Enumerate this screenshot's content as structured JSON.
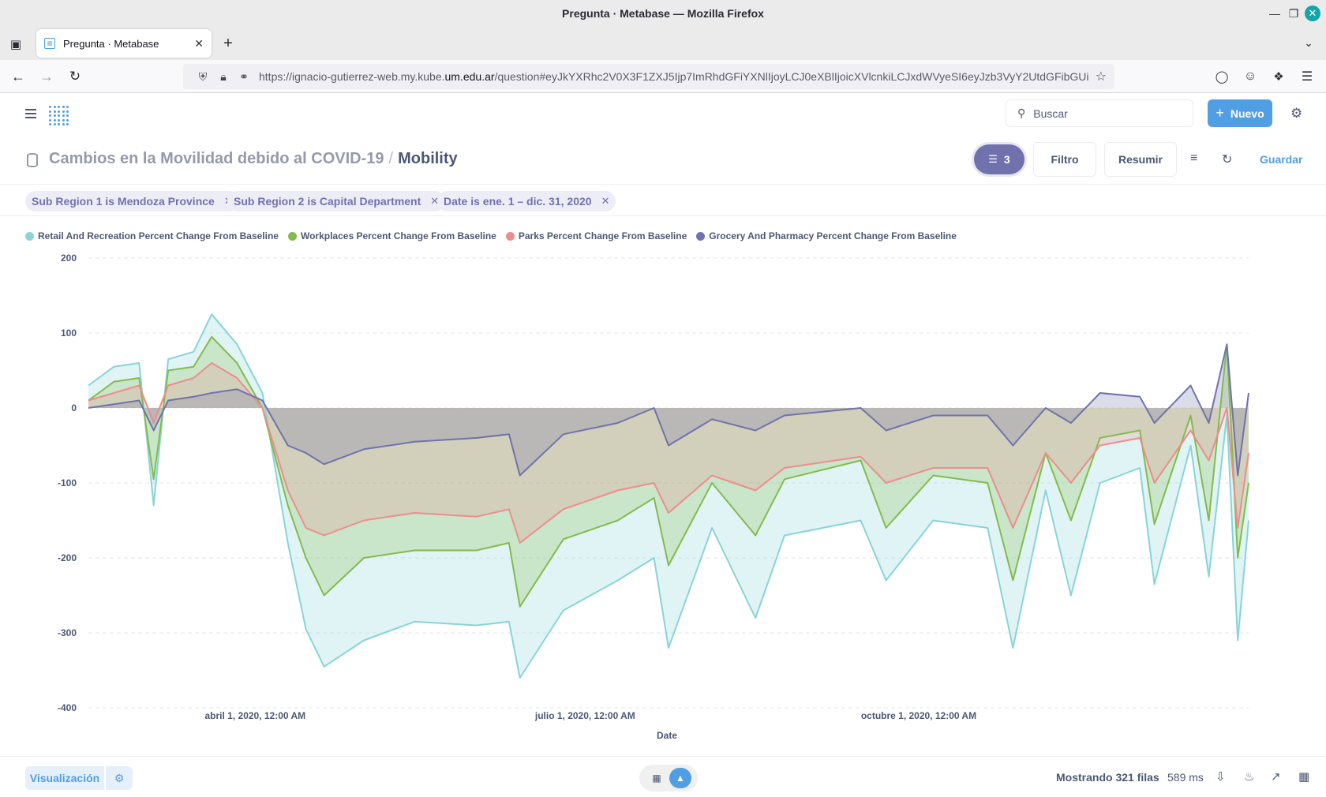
{
  "browser": {
    "window_title": "Pregunta · Metabase — Mozilla Firefox",
    "tab_title": "Pregunta · Metabase",
    "url_prefix": "https://ignacio-gutierrez-web.my.kube.",
    "url_domain": "um.edu.ar",
    "url_suffix": "/question#eyJkYXRhc2V0X3F1ZXJ5Ijp7ImRhdGFiYXNlIjoyLCJ0eXBlIjoicXVlcnkiLCJxdWVyeSI6eyJzb3VyY2UtdGFibGUi"
  },
  "header": {
    "search_placeholder": "Buscar",
    "new_label": "Nuevo"
  },
  "question": {
    "collection": "Cambios en la Movilidad debido al COVID-19",
    "separator": "/",
    "table": "Mobility",
    "filter_count": "3",
    "filter_btn": "Filtro",
    "summarize_btn": "Resumir",
    "save_btn": "Guardar"
  },
  "filters": [
    "Sub Region 1 is Mendoza Province",
    "Sub Region 2 is Capital Department",
    "Date is ene. 1 – dic. 31, 2020"
  ],
  "footer": {
    "viz_label": "Visualización",
    "rows_text": "Mostrando 321 filas",
    "time_text": "589 ms"
  },
  "colors": {
    "accent": "#509ee3",
    "filter": "#7172ad",
    "retail": "#88d4d8",
    "workplaces": "#84bb4c",
    "parks": "#ef8c8c",
    "grocery": "#7172ad"
  },
  "chart_data": {
    "type": "area",
    "xlabel": "Date",
    "ylabel": "",
    "x_range": [
      "2020-02-15",
      "2020-12-31"
    ],
    "x_ticks": [
      "abril 1, 2020, 12:00 AM",
      "julio 1, 2020, 12:00 AM",
      "octubre 1, 2020, 12:00 AM"
    ],
    "ylim": [
      -400,
      200
    ],
    "y_ticks": [
      "200",
      "100",
      "0",
      "-100",
      "-200",
      "-300",
      "-400"
    ],
    "legend_position": "top-left",
    "series": [
      {
        "name": "Retail And Recreation Percent Change From Baseline",
        "values": [
          [
            "2020-02-15",
            30
          ],
          [
            "2020-02-22",
            55
          ],
          [
            "2020-02-29",
            60
          ],
          [
            "2020-03-04",
            -130
          ],
          [
            "2020-03-08",
            65
          ],
          [
            "2020-03-15",
            75
          ],
          [
            "2020-03-20",
            125
          ],
          [
            "2020-03-27",
            85
          ],
          [
            "2020-04-03",
            20
          ],
          [
            "2020-04-10",
            -180
          ],
          [
            "2020-04-15",
            -295
          ],
          [
            "2020-04-20",
            -345
          ],
          [
            "2020-05-01",
            -310
          ],
          [
            "2020-05-15",
            -285
          ],
          [
            "2020-06-01",
            -290
          ],
          [
            "2020-06-10",
            -285
          ],
          [
            "2020-06-13",
            -360
          ],
          [
            "2020-06-25",
            -270
          ],
          [
            "2020-07-10",
            -230
          ],
          [
            "2020-07-20",
            -200
          ],
          [
            "2020-07-24",
            -320
          ],
          [
            "2020-08-05",
            -160
          ],
          [
            "2020-08-17",
            -280
          ],
          [
            "2020-08-25",
            -170
          ],
          [
            "2020-09-15",
            -150
          ],
          [
            "2020-09-22",
            -230
          ],
          [
            "2020-10-05",
            -150
          ],
          [
            "2020-10-20",
            -160
          ],
          [
            "2020-10-27",
            -320
          ],
          [
            "2020-11-05",
            -110
          ],
          [
            "2020-11-12",
            -250
          ],
          [
            "2020-11-20",
            -100
          ],
          [
            "2020-12-01",
            -80
          ],
          [
            "2020-12-05",
            -235
          ],
          [
            "2020-12-15",
            -50
          ],
          [
            "2020-12-20",
            -225
          ],
          [
            "2020-12-25",
            -10
          ],
          [
            "2020-12-28",
            -310
          ],
          [
            "2020-12-31",
            -150
          ]
        ]
      },
      {
        "name": "Workplaces Percent Change From Baseline",
        "values": [
          [
            "2020-02-15",
            10
          ],
          [
            "2020-02-22",
            35
          ],
          [
            "2020-02-29",
            40
          ],
          [
            "2020-03-04",
            -95
          ],
          [
            "2020-03-08",
            50
          ],
          [
            "2020-03-15",
            55
          ],
          [
            "2020-03-20",
            95
          ],
          [
            "2020-03-27",
            60
          ],
          [
            "2020-04-03",
            0
          ],
          [
            "2020-04-10",
            -130
          ],
          [
            "2020-04-15",
            -200
          ],
          [
            "2020-04-20",
            -250
          ],
          [
            "2020-05-01",
            -200
          ],
          [
            "2020-05-15",
            -190
          ],
          [
            "2020-06-01",
            -190
          ],
          [
            "2020-06-10",
            -180
          ],
          [
            "2020-06-13",
            -265
          ],
          [
            "2020-06-25",
            -175
          ],
          [
            "2020-07-10",
            -150
          ],
          [
            "2020-07-20",
            -120
          ],
          [
            "2020-07-24",
            -210
          ],
          [
            "2020-08-05",
            -100
          ],
          [
            "2020-08-17",
            -170
          ],
          [
            "2020-08-25",
            -95
          ],
          [
            "2020-09-15",
            -70
          ],
          [
            "2020-09-22",
            -160
          ],
          [
            "2020-10-05",
            -90
          ],
          [
            "2020-10-20",
            -100
          ],
          [
            "2020-10-27",
            -230
          ],
          [
            "2020-11-05",
            -60
          ],
          [
            "2020-11-12",
            -150
          ],
          [
            "2020-11-20",
            -40
          ],
          [
            "2020-12-01",
            -30
          ],
          [
            "2020-12-05",
            -155
          ],
          [
            "2020-12-15",
            -10
          ],
          [
            "2020-12-20",
            -150
          ],
          [
            "2020-12-25",
            85
          ],
          [
            "2020-12-28",
            -200
          ],
          [
            "2020-12-31",
            -100
          ]
        ]
      },
      {
        "name": "Parks Percent Change From Baseline",
        "values": [
          [
            "2020-02-15",
            10
          ],
          [
            "2020-02-22",
            20
          ],
          [
            "2020-02-29",
            30
          ],
          [
            "2020-03-04",
            -20
          ],
          [
            "2020-03-08",
            30
          ],
          [
            "2020-03-15",
            40
          ],
          [
            "2020-03-20",
            60
          ],
          [
            "2020-03-27",
            40
          ],
          [
            "2020-04-03",
            0
          ],
          [
            "2020-04-10",
            -110
          ],
          [
            "2020-04-15",
            -160
          ],
          [
            "2020-04-20",
            -170
          ],
          [
            "2020-05-01",
            -150
          ],
          [
            "2020-05-15",
            -140
          ],
          [
            "2020-06-01",
            -145
          ],
          [
            "2020-06-10",
            -135
          ],
          [
            "2020-06-13",
            -180
          ],
          [
            "2020-06-25",
            -135
          ],
          [
            "2020-07-10",
            -110
          ],
          [
            "2020-07-20",
            -100
          ],
          [
            "2020-07-24",
            -140
          ],
          [
            "2020-08-05",
            -90
          ],
          [
            "2020-08-17",
            -110
          ],
          [
            "2020-08-25",
            -80
          ],
          [
            "2020-09-15",
            -65
          ],
          [
            "2020-09-22",
            -100
          ],
          [
            "2020-10-05",
            -80
          ],
          [
            "2020-10-20",
            -80
          ],
          [
            "2020-10-27",
            -160
          ],
          [
            "2020-11-05",
            -60
          ],
          [
            "2020-11-12",
            -100
          ],
          [
            "2020-11-20",
            -50
          ],
          [
            "2020-12-01",
            -40
          ],
          [
            "2020-12-05",
            -100
          ],
          [
            "2020-12-15",
            -30
          ],
          [
            "2020-12-20",
            -70
          ],
          [
            "2020-12-25",
            0
          ],
          [
            "2020-12-28",
            -160
          ],
          [
            "2020-12-31",
            -60
          ]
        ]
      },
      {
        "name": "Grocery And Pharmacy Percent Change From Baseline",
        "values": [
          [
            "2020-02-15",
            0
          ],
          [
            "2020-02-22",
            5
          ],
          [
            "2020-02-29",
            10
          ],
          [
            "2020-03-04",
            -30
          ],
          [
            "2020-03-08",
            10
          ],
          [
            "2020-03-15",
            15
          ],
          [
            "2020-03-20",
            20
          ],
          [
            "2020-03-27",
            25
          ],
          [
            "2020-04-03",
            10
          ],
          [
            "2020-04-10",
            -50
          ],
          [
            "2020-04-15",
            -60
          ],
          [
            "2020-04-20",
            -75
          ],
          [
            "2020-05-01",
            -55
          ],
          [
            "2020-05-15",
            -45
          ],
          [
            "2020-06-01",
            -40
          ],
          [
            "2020-06-10",
            -35
          ],
          [
            "2020-06-13",
            -90
          ],
          [
            "2020-06-25",
            -35
          ],
          [
            "2020-07-10",
            -20
          ],
          [
            "2020-07-20",
            0
          ],
          [
            "2020-07-24",
            -50
          ],
          [
            "2020-08-05",
            -15
          ],
          [
            "2020-08-17",
            -30
          ],
          [
            "2020-08-25",
            -10
          ],
          [
            "2020-09-15",
            0
          ],
          [
            "2020-09-22",
            -30
          ],
          [
            "2020-10-05",
            -10
          ],
          [
            "2020-10-20",
            -10
          ],
          [
            "2020-10-27",
            -50
          ],
          [
            "2020-11-05",
            0
          ],
          [
            "2020-11-12",
            -20
          ],
          [
            "2020-11-20",
            20
          ],
          [
            "2020-12-01",
            15
          ],
          [
            "2020-12-05",
            -20
          ],
          [
            "2020-12-15",
            30
          ],
          [
            "2020-12-20",
            -20
          ],
          [
            "2020-12-25",
            85
          ],
          [
            "2020-12-28",
            -90
          ],
          [
            "2020-12-31",
            20
          ]
        ]
      }
    ]
  }
}
